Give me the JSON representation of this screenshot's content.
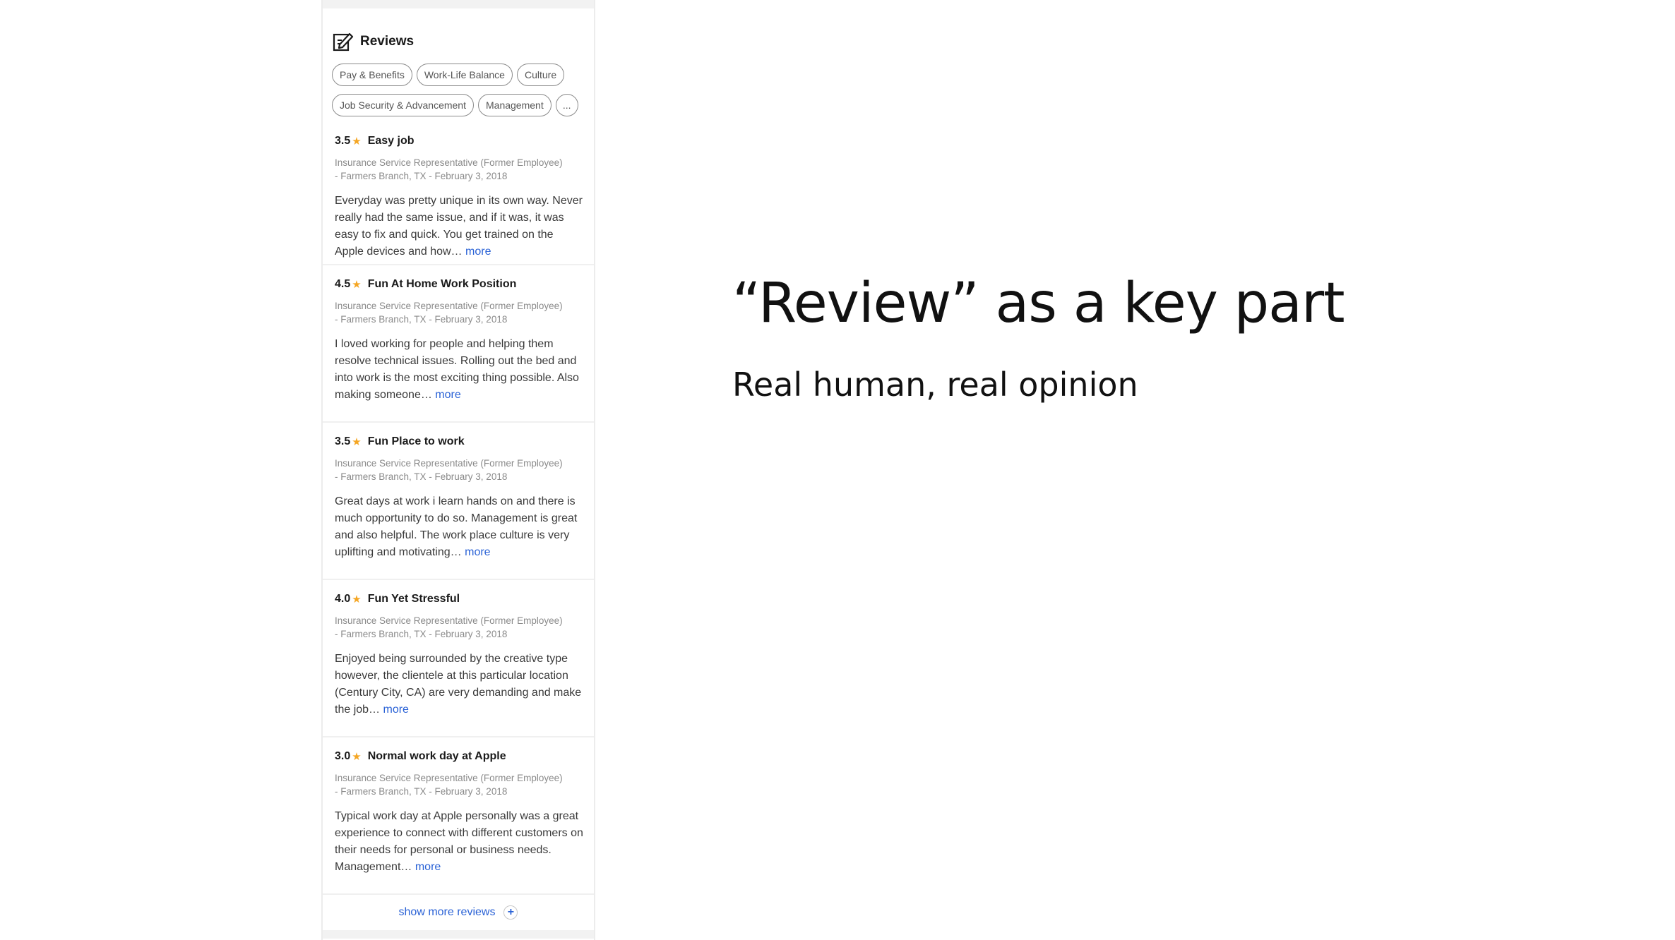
{
  "panel": {
    "title": "Reviews",
    "chips": [
      "Pay & Benefits",
      "Work-Life Balance",
      "Culture",
      "Job Security & Advancement",
      "Management",
      "..."
    ],
    "reviews": [
      {
        "rating": "3.5",
        "title": "Easy job",
        "meta_line1": "Insurance Service Representative (Former Employee)",
        "meta_line2": "- Farmers Branch, TX - February 3, 2018",
        "body": "Everyday was pretty unique in its own way. Never really had the same issue, and if it was, it was easy to fix and quick. You get trained on the Apple devices and how…",
        "more": "more"
      },
      {
        "rating": "4.5",
        "title": "Fun At Home Work Position",
        "meta_line1": "Insurance Service Representative (Former Employee)",
        "meta_line2": "- Farmers Branch, TX - February 3, 2018",
        "body": "I loved working for people and helping them resolve technical issues. Rolling out the bed and into work is the most exciting thing possible. Also making someone…",
        "more": "more"
      },
      {
        "rating": "3.5",
        "title": "Fun Place to work",
        "meta_line1": "Insurance Service Representative (Former Employee)",
        "meta_line2": "- Farmers Branch, TX - February 3, 2018",
        "body": "Great days at work i learn hands on and there is much opportunity to do so. Management is great and also helpful. The work place culture is very uplifting and motivating…",
        "more": "more"
      },
      {
        "rating": "4.0",
        "title": "Fun Yet Stressful",
        "meta_line1": "Insurance Service Representative (Former Employee)",
        "meta_line2": "- Farmers Branch, TX - February 3, 2018",
        "body": "Enjoyed being surrounded by the creative type however, the clientele at this particular location (Century City, CA) are very demanding and make the job…",
        "more": "more"
      },
      {
        "rating": "3.0",
        "title": "Normal work day at Apple",
        "meta_line1": "Insurance Service Representative (Former Employee)",
        "meta_line2": "- Farmers Branch, TX - February 3, 2018",
        "body": "Typical work day at Apple personally was a great experience to connect with different customers on their needs for personal or business needs. Management…",
        "more": "more"
      }
    ],
    "show_more": "show more reviews",
    "plus_glyph": "+"
  },
  "slide": {
    "title": "“Review” as a key part",
    "subtitle": "Real human, real opinion"
  },
  "colors": {
    "star": "#f5a623",
    "link": "#2a62d6"
  }
}
